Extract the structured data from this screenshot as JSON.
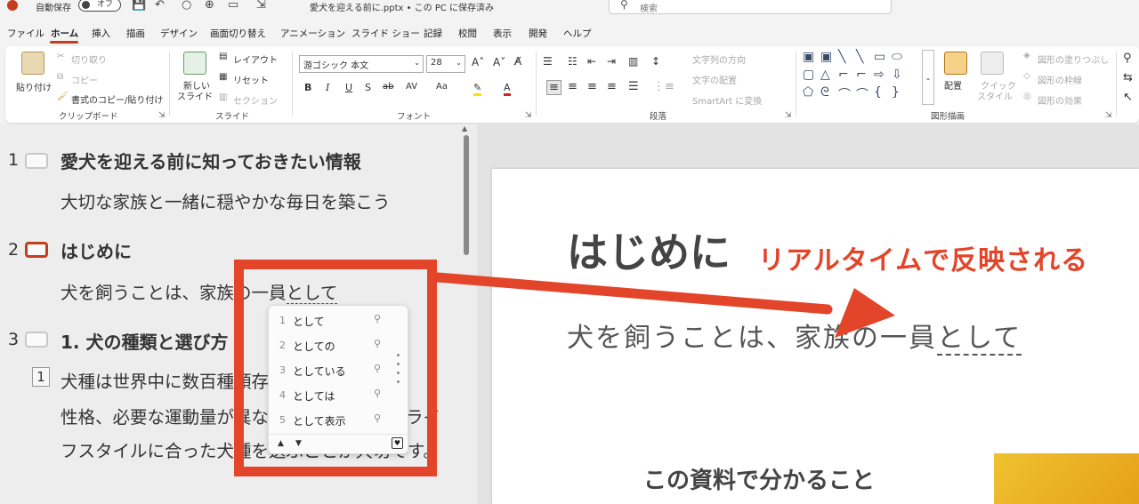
{
  "titlebar": {
    "autosave_label": "自動保存",
    "autosave_state": "オフ",
    "document_title": "愛犬を迎える前に.pptx • この PC に保存済み",
    "search_placeholder": "検索"
  },
  "tabs": [
    "ファイル",
    "ホーム",
    "挿入",
    "描画",
    "デザイン",
    "画面切り替え",
    "アニメーション",
    "スライド ショー",
    "記録",
    "校閲",
    "表示",
    "開発",
    "ヘルプ"
  ],
  "active_tab": "ホーム",
  "ribbon": {
    "clipboard": {
      "label": "クリップボード",
      "paste": "貼り付け",
      "cut": "切り取り",
      "copy": "コピー",
      "format_painter": "書式のコピー/貼り付け"
    },
    "slides": {
      "label": "スライド",
      "new_slide_line1": "新しい",
      "new_slide_line2": "スライド",
      "layout": "レイアウト",
      "reset": "リセット",
      "section": "セクション"
    },
    "font": {
      "label": "フォント",
      "font_name": "游ゴシック 本文",
      "font_size": "28"
    },
    "paragraph": {
      "label": "段落",
      "text_direction": "文字列の方向",
      "align_text": "文字の配置",
      "smartart": "SmartArt に変換"
    },
    "drawing": {
      "label": "図形描画",
      "arrange": "配置",
      "quick_style_line1": "クイック",
      "quick_style_line2": "スタイル",
      "shape_fill": "図形の塗りつぶし",
      "shape_outline": "図形の枠線",
      "shape_effects": "図形の効果"
    }
  },
  "outline": {
    "slides": [
      {
        "number": "1",
        "title": "愛犬を迎える前に知っておきたい情報",
        "body": "大切な家族と一緒に穏やかな毎日を築こう"
      },
      {
        "number": "2",
        "title": "はじめに",
        "body_prefix": "犬を飼うことは、家族の一員",
        "body_underlined": "として"
      },
      {
        "number": "3",
        "title": "1. 犬の種類と選び方",
        "para_number": "1",
        "body_line1": "犬種は世界中に数百種類存在し、体格や",
        "body_line2": "性格、必要な運動量が異なります。あなたのライ",
        "body_line3": "フスタイルに合った犬種を選ぶことが大切です。"
      }
    ]
  },
  "ime_candidates": [
    {
      "n": "1",
      "text": "として"
    },
    {
      "n": "2",
      "text": "としての"
    },
    {
      "n": "3",
      "text": "としている"
    },
    {
      "n": "4",
      "text": "としては"
    },
    {
      "n": "5",
      "text": "として表示"
    }
  ],
  "slide": {
    "title": "はじめに",
    "body_prefix": "犬を飼うことは、家族の一員",
    "body_underlined": "として",
    "subtitle": "この資料で分かること"
  },
  "annotation": {
    "text": "リアルタイムで反映される",
    "color": "#e2452a"
  },
  "colors": {
    "accent": "#c43e1c",
    "annotation": "#e2452a"
  }
}
